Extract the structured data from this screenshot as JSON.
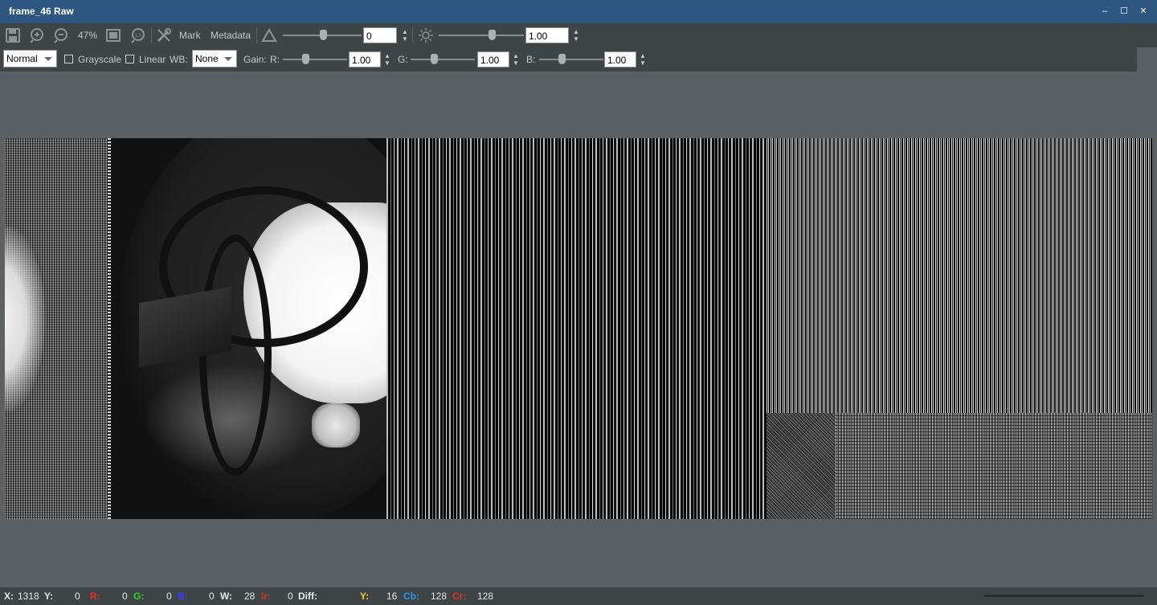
{
  "window": {
    "title": "frame_46 Raw",
    "minimize_glyph": "–",
    "maximize_glyph": "☐",
    "close_glyph": "✕"
  },
  "toolbar1": {
    "zoom": "47%",
    "mark_label": "Mark",
    "metadata_label": "Metadata",
    "contrast_value": "0",
    "brightness_value": "1.00",
    "icons": [
      "save-icon",
      "zoom-in-icon",
      "zoom-out-icon",
      "fit-window-icon",
      "actual-size-icon",
      "tools-icon",
      "triangle-contrast-icon",
      "sun-brightness-icon"
    ]
  },
  "toolbar2": {
    "mode": "Normal",
    "grayscale_label": "Grayscale",
    "linear_label": "Linear",
    "wb_label": "WB:",
    "wb_value": "None",
    "gain_label": "Gain:",
    "r_label": "R:",
    "r_value": "1.00",
    "g_label": "G:",
    "g_value": "1.00",
    "b_label": "B:",
    "b_value": "1.00"
  },
  "status": {
    "x_label": "X:",
    "x_value": "1318",
    "y_label": "Y:",
    "y_value": "0",
    "r_label": "R:",
    "r_value": "0",
    "g_label": "G:",
    "g_value": "0",
    "b_label": "B:",
    "b_value": "0",
    "w_label": "W:",
    "w_value": "28",
    "ir_label": "Ir:",
    "ir_value": "0",
    "diff_label": "Diff:",
    "yy_label": "Y:",
    "yy_value": "16",
    "cb_label": "Cb:",
    "cb_value": "128",
    "cr_label": "Cr:",
    "cr_value": "128"
  },
  "colors": {
    "titlebar": "#2d5680",
    "toolbar": "#3f4446",
    "background": "#5b6064",
    "r": "#e0302a",
    "g": "#2fd42f",
    "b": "#2a2aff",
    "y_yellow": "#e6d430",
    "cb": "#2f8ee6",
    "cr": "#e0302a"
  }
}
